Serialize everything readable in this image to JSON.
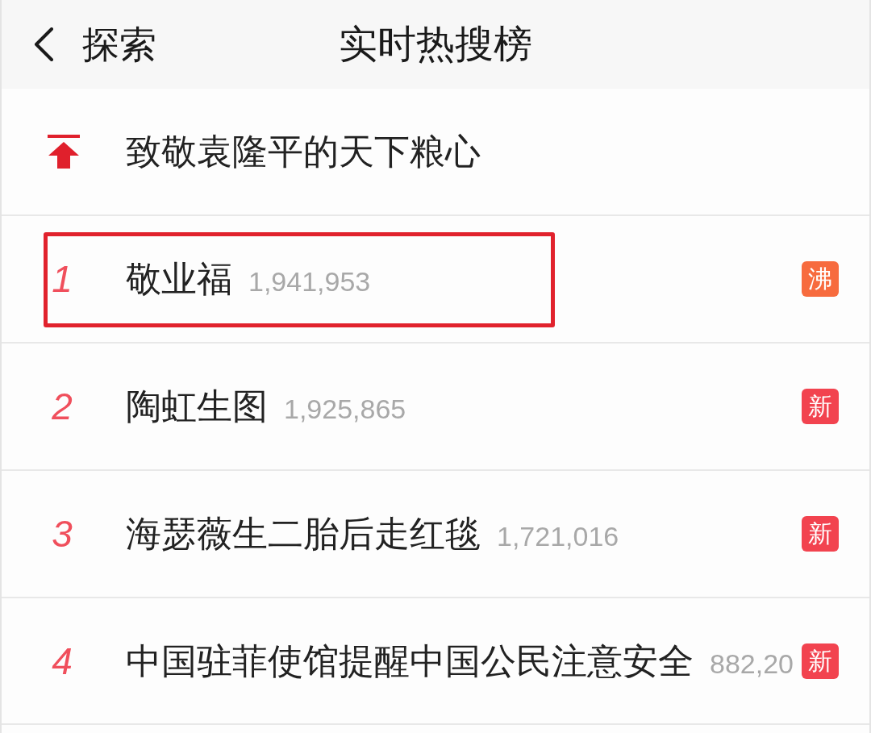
{
  "header": {
    "back_label": "探索",
    "title": "实时热搜榜"
  },
  "pinned": {
    "title": "致敬袁隆平的天下粮心"
  },
  "rows": [
    {
      "rank": "1",
      "title": "敬业福",
      "count": "1,941,953",
      "badge": {
        "label": "沸",
        "color": "#f76b3e"
      },
      "highlighted": true
    },
    {
      "rank": "2",
      "title": "陶虹生图",
      "count": "1,925,865",
      "badge": {
        "label": "新",
        "color": "#f2434f"
      },
      "highlighted": false
    },
    {
      "rank": "3",
      "title": "海瑟薇生二胎后走红毯",
      "count": "1,721,016",
      "badge": {
        "label": "新",
        "color": "#f2434f"
      },
      "highlighted": false
    },
    {
      "rank": "4",
      "title": "中国驻菲使馆提醒中国公民注意安全",
      "count": "882,20",
      "badge": {
        "label": "新",
        "color": "#f2434f"
      },
      "highlighted": false
    }
  ]
}
